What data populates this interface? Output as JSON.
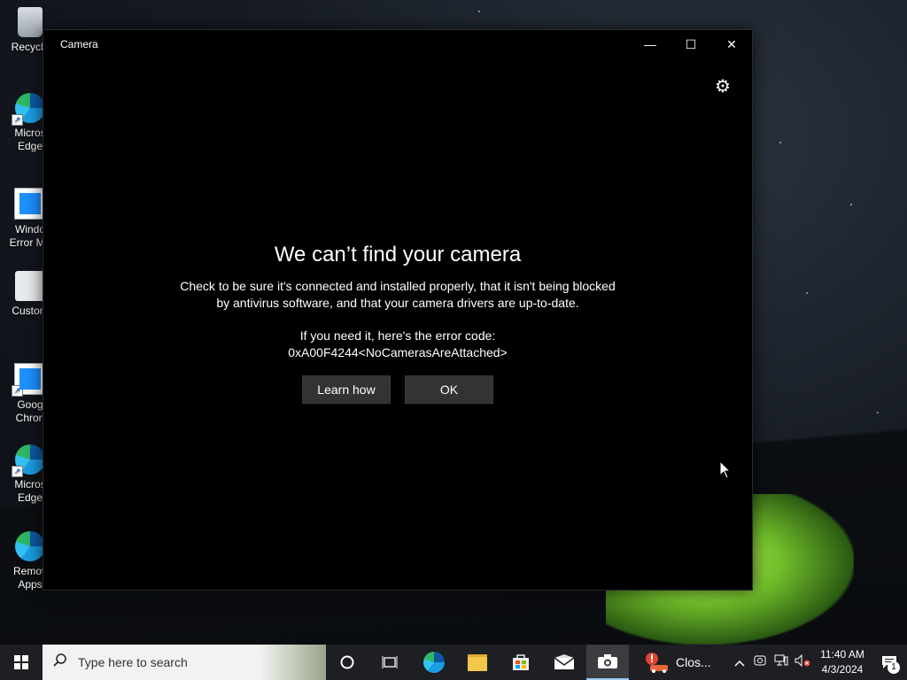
{
  "desktop": {
    "icons": [
      {
        "label": "Recycle",
        "icon": "recycle-bin-icon"
      },
      {
        "label": "Micros\nEdge",
        "icon": "edge-icon"
      },
      {
        "label": "Windo\nError Me",
        "icon": "document-icon"
      },
      {
        "label": "Custom",
        "icon": "gear-document-icon"
      },
      {
        "label": "Goog\nChron",
        "icon": "document-icon"
      },
      {
        "label": "Micros\nEdge",
        "icon": "edge-icon"
      },
      {
        "label": "Remov\nApps",
        "icon": "edge-icon"
      }
    ]
  },
  "window": {
    "title": "Camera",
    "controls": {
      "minimize": "—",
      "maximize": "☐",
      "close": "✕"
    },
    "settings_icon": "⚙",
    "error": {
      "title": "We can’t find your camera",
      "body_line1": "Check to be sure it's connected and installed properly, that it isn't being blocked",
      "body_line2": "by antivirus software, and that your camera drivers are up-to-date.",
      "code_intro": "If you need it, here's the error code:",
      "code": "0xA00F4244<NoCamerasAreAttached>",
      "learn_how": "Learn how",
      "ok": "OK"
    }
  },
  "taskbar": {
    "search_placeholder": "Type here to search",
    "notification_app_label": "Clos...",
    "clock_time": "11:40 AM",
    "clock_date": "4/3/2024",
    "notification_count": "1",
    "colors": {
      "bar": "#1d1f22",
      "active": "#3a3c40",
      "accent": "#9ec9f1"
    }
  }
}
